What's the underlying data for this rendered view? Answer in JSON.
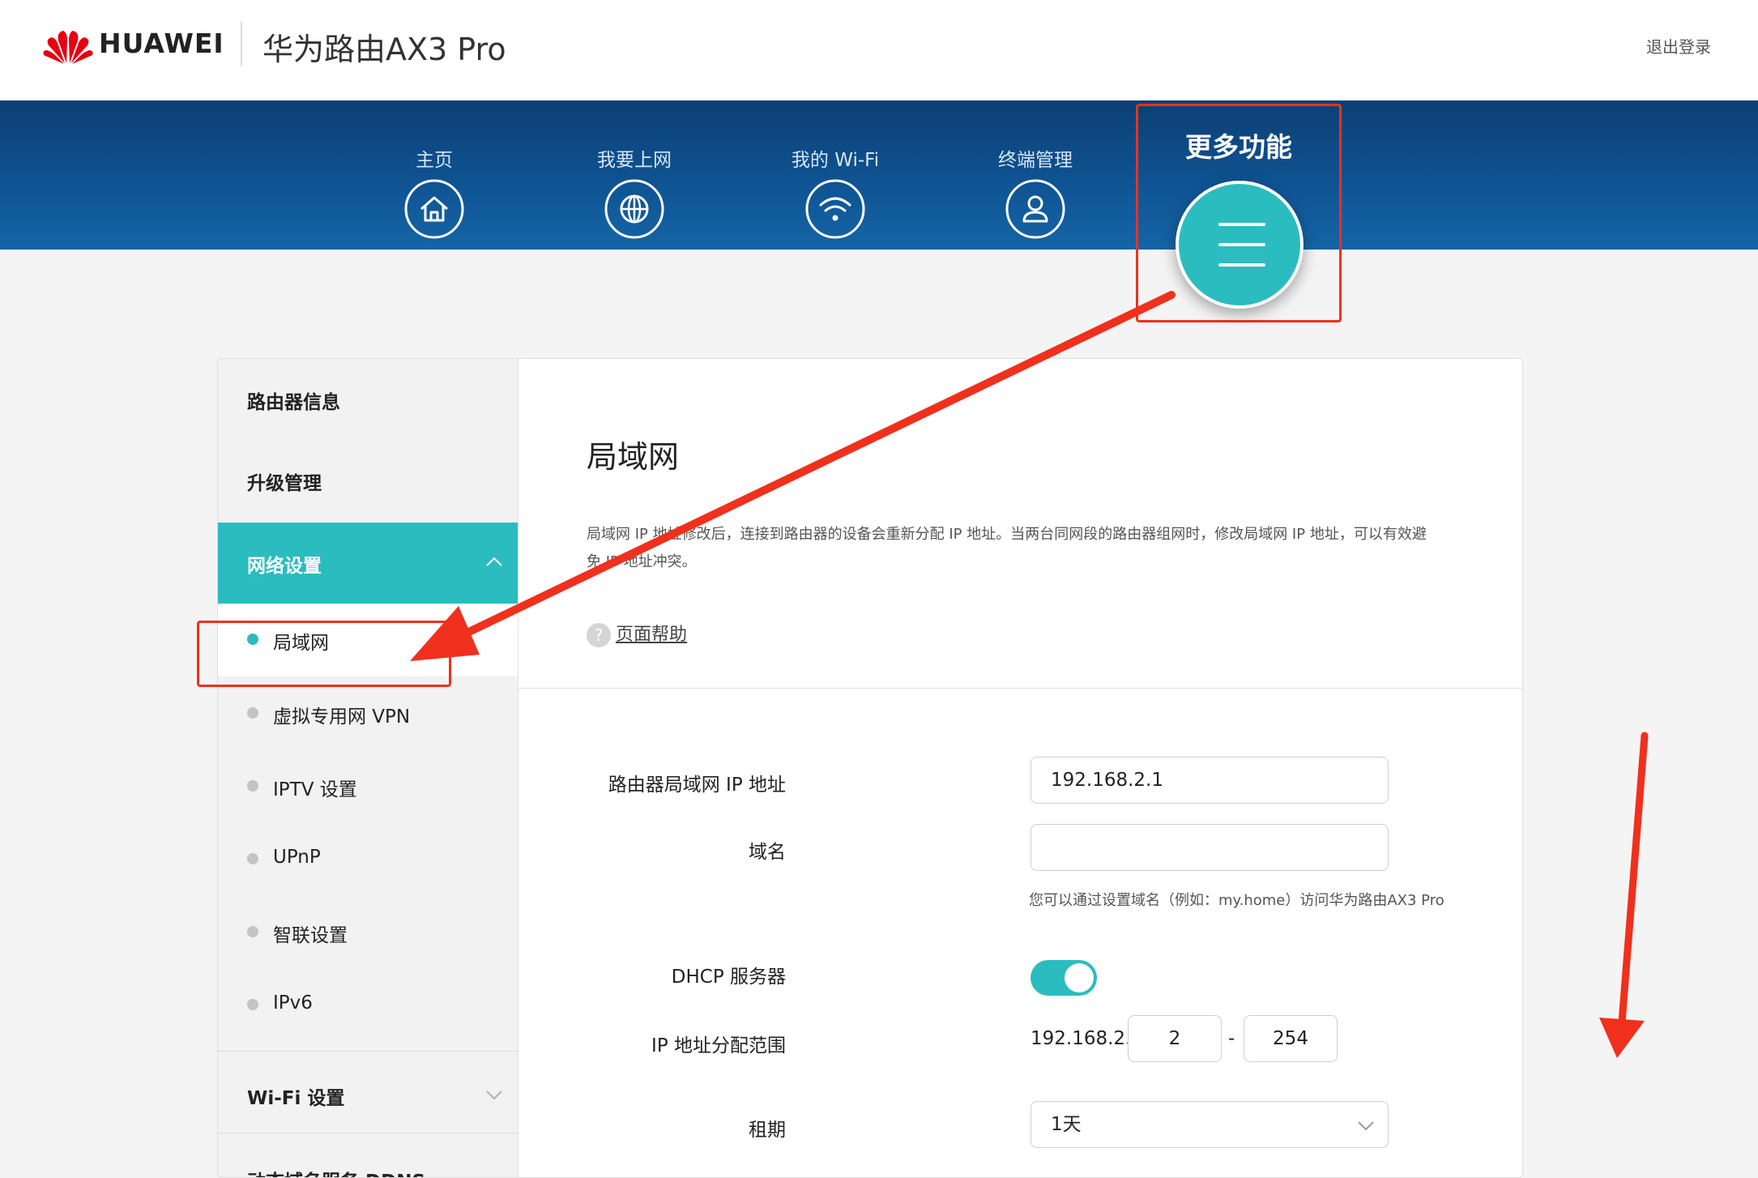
{
  "header": {
    "brand": "HUAWEI",
    "product": "华为路由AX3 Pro",
    "logout": "退出登录"
  },
  "nav": {
    "items": [
      {
        "label": "主页",
        "icon": "home-icon"
      },
      {
        "label": "我要上网",
        "icon": "globe-icon"
      },
      {
        "label": "我的 Wi-Fi",
        "icon": "wifi-icon"
      },
      {
        "label": "终端管理",
        "icon": "user-icon"
      }
    ],
    "more": {
      "label": "更多功能",
      "icon": "menu-icon"
    }
  },
  "sidebar": {
    "items": [
      {
        "label": "路由器信息"
      },
      {
        "label": "升级管理"
      },
      {
        "label": "网络设置"
      }
    ],
    "subitems": [
      {
        "label": "局域网"
      },
      {
        "label": "虚拟专用网 VPN"
      },
      {
        "label": "IPTV 设置"
      },
      {
        "label": "UPnP"
      },
      {
        "label": "智联设置"
      },
      {
        "label": "IPv6"
      }
    ],
    "wifi": {
      "label": "Wi-Fi 设置"
    },
    "ddns": {
      "label": "动态域名服务 DDNS"
    }
  },
  "page": {
    "title": "局域网",
    "description": "局域网 IP 地址修改后，连接到路由器的设备会重新分配 IP 地址。当两台同网段的路由器组网时，修改局域网 IP 地址，可以有效避免 IP 地址冲突。",
    "help": "页面帮助"
  },
  "form": {
    "lan_ip_label": "路由器局域网 IP 地址",
    "lan_ip_value": "192.168.2.1",
    "domain_label": "域名",
    "domain_value": "",
    "domain_hint": "您可以通过设置域名（例如：my.home）访问华为路由AX3 Pro",
    "dhcp_label": "DHCP 服务器",
    "dhcp_enabled": true,
    "range_label": "IP 地址分配范围",
    "range_prefix": "192.168.2.",
    "range_start": "2",
    "range_sep": "-",
    "range_end": "254",
    "lease_label": "租期",
    "lease_value": "1天"
  },
  "colors": {
    "accent": "#2bbcbf",
    "nav_bg": "#0f5393",
    "annotation": "#f0301c"
  }
}
